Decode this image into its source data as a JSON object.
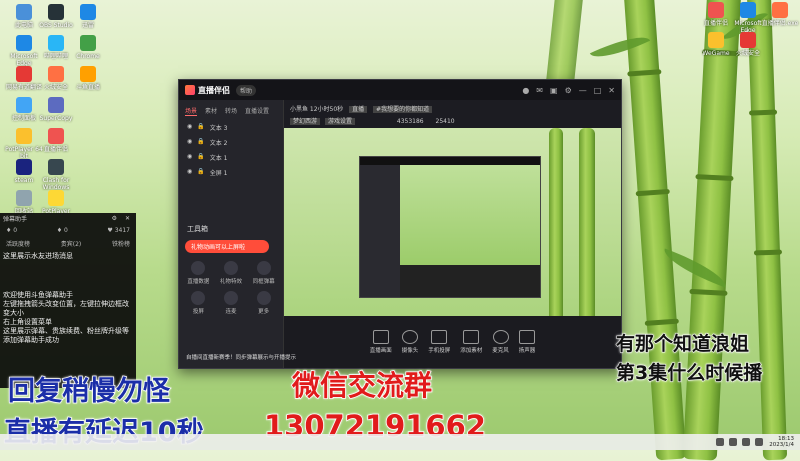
{
  "desktop": {
    "icons_left": [
      {
        "label": "此电脑",
        "color": "#4a90d9"
      },
      {
        "label": "Microsoft Edge",
        "color": "#1e88e5"
      },
      {
        "label": "网易有道翻译",
        "color": "#e53935"
      },
      {
        "label": "控制面板",
        "color": "#42a5f5"
      },
      {
        "label": "PotPlayer 64 bit",
        "color": "#fbc02d"
      },
      {
        "label": "steam",
        "color": "#1a237e"
      },
      {
        "label": "回收站",
        "color": "#90a4ae"
      },
      {
        "label": "OBS Studio",
        "color": "#263238"
      },
      {
        "label": "哔哩哔哩",
        "color": "#29b6f6"
      },
      {
        "label": "火绒安全",
        "color": "#ff7043"
      },
      {
        "label": "SuperCopy",
        "color": "#5c6bc0"
      },
      {
        "label": "直播伴侣",
        "color": "#ef5350"
      },
      {
        "label": "Clash for Windows",
        "color": "#37474f"
      },
      {
        "label": "PotPlayer",
        "color": "#fdd835"
      },
      {
        "label": "迅雷",
        "color": "#1e88e5"
      },
      {
        "label": "Chrome",
        "color": "#43a047"
      },
      {
        "label": "斗鱼直播",
        "color": "#ffa000"
      }
    ],
    "icons_right": [
      {
        "label": "直播伴侣",
        "color": "#ef5350"
      },
      {
        "label": "Microsoft Edge",
        "color": "#1e88e5"
      },
      {
        "label": "直播伴侣.exe",
        "color": "#ff7043"
      },
      {
        "label": "WeGame",
        "color": "#fbc02d"
      },
      {
        "label": "火绒安全",
        "color": "#e53935"
      }
    ]
  },
  "app": {
    "title": "直播伴侣",
    "badge": "帮助",
    "toolbar_icons": [
      "avatar-icon",
      "mail-icon",
      "gift-icon",
      "settings-icon",
      "minimize-icon",
      "maximize-icon",
      "close-icon"
    ],
    "left_tabs": [
      "场景",
      "素材",
      "转场",
      "直播设置"
    ],
    "scenes": [
      "文本 3",
      "文本 2",
      "文本 1",
      "全屏 1"
    ],
    "tools_title": "工具箱",
    "banner": "礼物动画可以上屏啦",
    "tools": [
      "直播数据",
      "礼物特效",
      "同框弹幕",
      "投屏",
      "连麦",
      "更多"
    ],
    "room": {
      "title": "小黑鱼 12小时50秒",
      "tag1": "直播",
      "tag2": "#我想要的你都知道",
      "sub1": "梦幻西游",
      "sub2": "游戏设置",
      "viewers": "4353186",
      "likes": "25410"
    },
    "bottom_buttons": [
      "直播画面",
      "摄像头",
      "手机投屏",
      "添加素材",
      "麦克风",
      "扬声器"
    ],
    "tip": "自播间直播新赛季！同步弹幕展示与开播提示"
  },
  "danmaku": {
    "title": "弹幕助手",
    "stats": {
      "likes": "0",
      "gifts": "0",
      "hearts": "3417"
    },
    "tabs": [
      "活跃度榜",
      "贵宾(2)",
      "铁粉榜"
    ],
    "hint": "这里展示水友进场消息",
    "messages": [
      "欢迎使用斗鱼弹幕助手",
      "左键拖拽箭头改变位置，左键拉伸边框改变大小",
      "右上角设置菜单",
      "这里展示弹幕、贵族续费、粉丝牌升级等",
      "添加弹幕助手成功"
    ]
  },
  "overlays": {
    "blue1": "回复稍慢勿怪",
    "blue2": "直播有延迟10秒",
    "red1": "微信交流群",
    "red2": "13072191662",
    "black1": "有那个知道浪姐",
    "black2": "第3集什么时候播"
  },
  "taskbar": {
    "time": "18:13",
    "date": "2023/1/4"
  }
}
